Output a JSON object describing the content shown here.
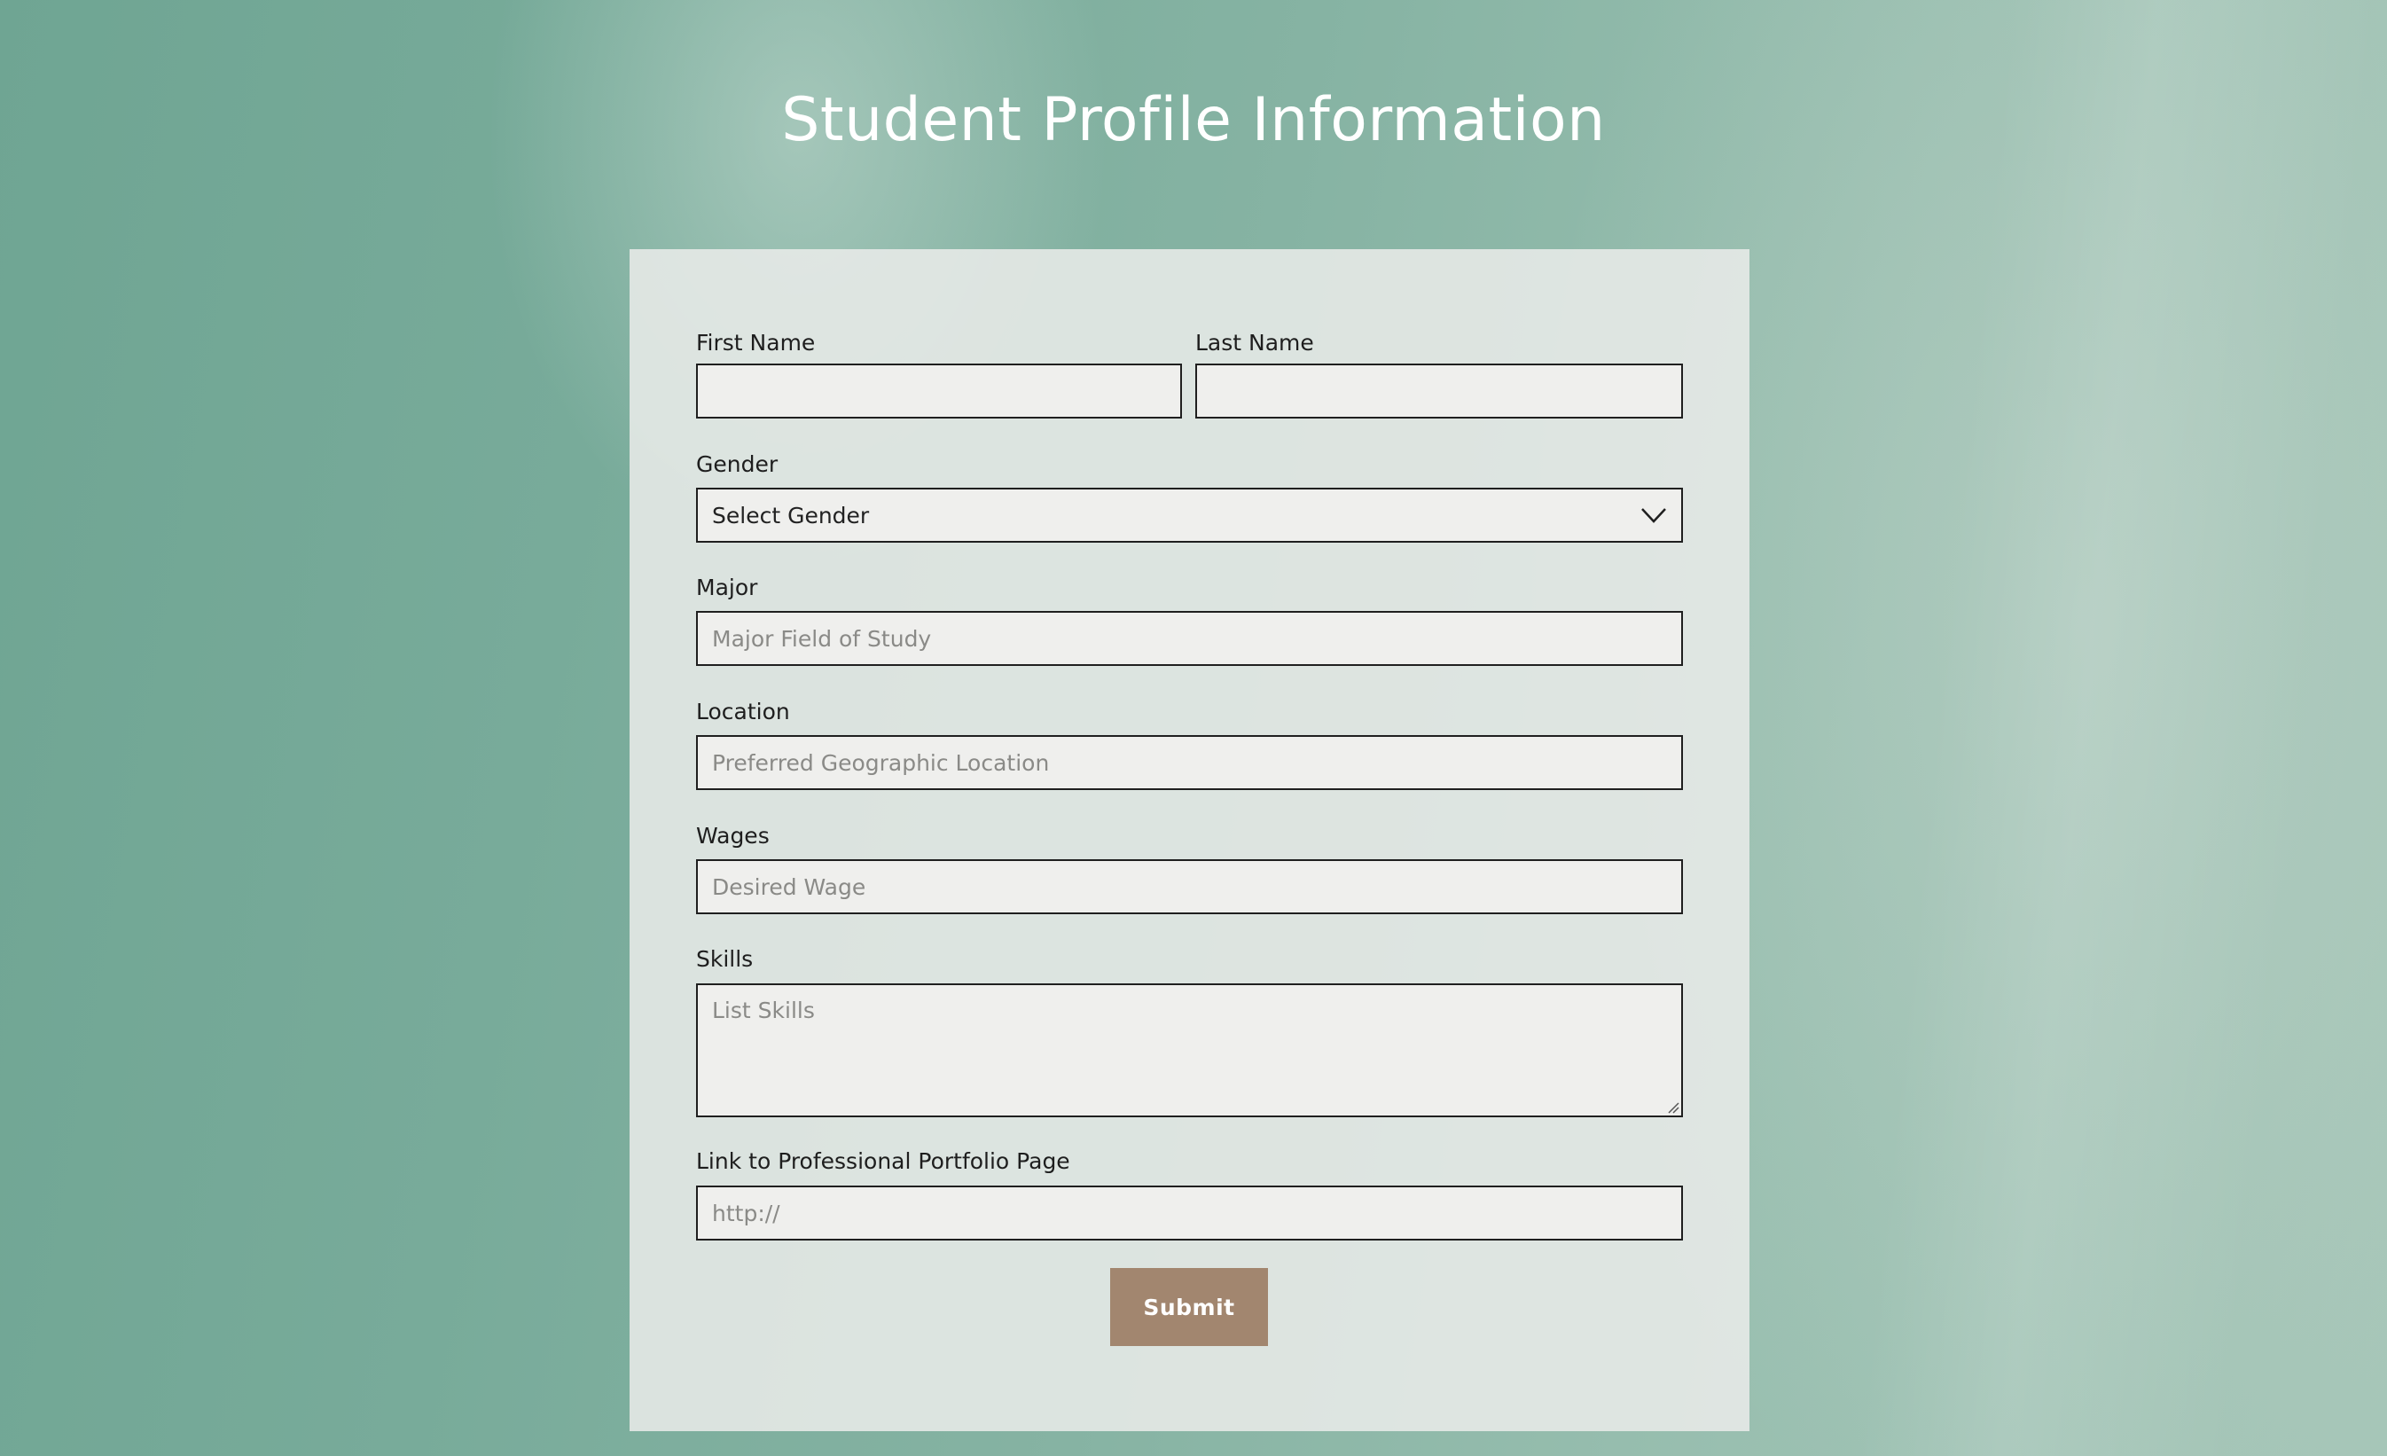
{
  "page": {
    "title": "Student Profile Information"
  },
  "form": {
    "first_name": {
      "label": "First Name",
      "value": "",
      "placeholder": ""
    },
    "last_name": {
      "label": "Last Name",
      "value": "",
      "placeholder": ""
    },
    "gender": {
      "label": "Gender",
      "selected": "Select Gender",
      "icon": "chevron-down-icon"
    },
    "major": {
      "label": "Major",
      "value": "",
      "placeholder": "Major Field of Study"
    },
    "location": {
      "label": "Location",
      "value": "",
      "placeholder": "Preferred Geographic Location"
    },
    "wages": {
      "label": "Wages",
      "value": "",
      "placeholder": "Desired Wage"
    },
    "skills": {
      "label": "Skills",
      "value": "",
      "placeholder": "List Skills",
      "icon": "resize-grip-icon"
    },
    "portfolio": {
      "label": "Link to Professional Portfolio Page",
      "value": "",
      "placeholder": "http://"
    },
    "submit_label": "Submit"
  },
  "colors": {
    "background": "#78ab9a",
    "card": "#e8ebe8",
    "field_border": "#1f1f1f",
    "field_fill": "#efefed",
    "button": "#a2866f",
    "button_text": "#ffffff",
    "title_text": "#ffffff"
  }
}
